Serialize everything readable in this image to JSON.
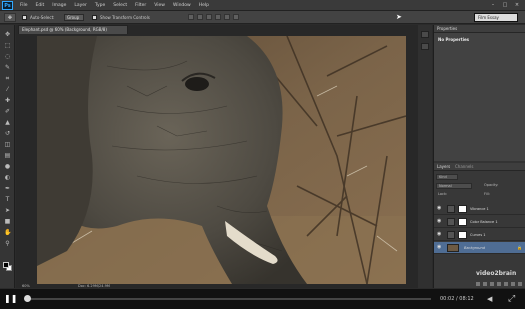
{
  "app": {
    "logo": "Ps",
    "menu": [
      "File",
      "Edit",
      "Image",
      "Layer",
      "Type",
      "Select",
      "Filter",
      "View",
      "Window",
      "Help"
    ],
    "window_controls": [
      "–",
      "□",
      "×"
    ]
  },
  "options_bar": {
    "tool_icon": "move-tool-icon",
    "auto_select_label": "Auto-Select:",
    "auto_select_target": "Group",
    "show_transform_label": "Show Transform Controls",
    "workspace": "Film Essay"
  },
  "document": {
    "tab_title": "Elephant.psd @ 60% (Background, RGB/8)",
    "zoom": "60%",
    "doc_size": "Doc: 6.29M/24.9M"
  },
  "properties_panel": {
    "tab": "Properties",
    "empty_text": "No Properties"
  },
  "layers_panel": {
    "tabs": [
      "Layers",
      "Channels"
    ],
    "kind_filter": "Kind",
    "blend_mode": "Normal",
    "opacity_label": "Opacity:",
    "lock_label": "Lock:",
    "fill_label": "Fill:",
    "layers": [
      {
        "name": "Vibrance 1",
        "type": "adjustment",
        "selected": false
      },
      {
        "name": "Color Balance 1",
        "type": "adjustment",
        "selected": false
      },
      {
        "name": "Curves 1",
        "type": "adjustment",
        "selected": false
      },
      {
        "name": "Background",
        "type": "image",
        "selected": true
      }
    ]
  },
  "player": {
    "time": "00:02 / 08:12",
    "progress": 0.004,
    "watermark": "video2brain"
  }
}
